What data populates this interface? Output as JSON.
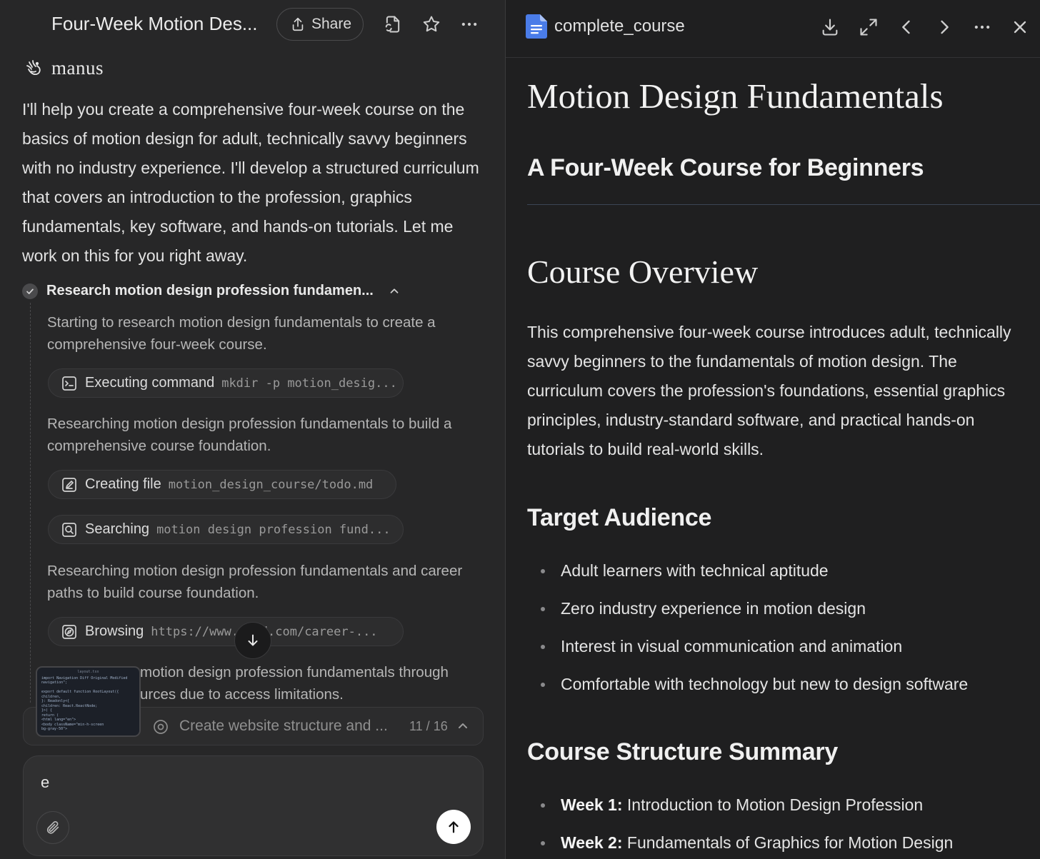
{
  "left": {
    "task_title": "Four-Week Motion Des...",
    "share_label": "Share",
    "brand": "manus",
    "intro": "I'll help you create a comprehensive four-week course on the basics of motion design for adult, technically savvy beginners with no industry experience. I'll develop a structured curriculum that covers an introduction to the profession, graphics fundamentals, key software, and hands-on tutorials. Let me work on this for you right away.",
    "step": {
      "title": "Research motion design profession fundamen...",
      "items": [
        {
          "type": "text",
          "text": "Starting to research motion design fundamentals to create a comprehensive four-week course."
        },
        {
          "type": "pill",
          "icon": "terminal-icon",
          "label": "Executing command",
          "detail": "mkdir -p motion_desig..."
        },
        {
          "type": "text",
          "text": "Researching motion design profession fundamentals to build a comprehensive course foundation."
        },
        {
          "type": "pill",
          "icon": "edit-file-icon",
          "label": "Creating file",
          "detail": "motion_design_course/todo.md"
        },
        {
          "type": "pill",
          "icon": "search-icon",
          "label": "Searching",
          "detail": "motion design profession fund..."
        },
        {
          "type": "text",
          "text": "Researching motion design profession fundamentals and career paths to build course foundation."
        },
        {
          "type": "pill",
          "icon": "compass-icon",
          "label": "Browsing",
          "detail": "https://www.    eed.com/career-..."
        },
        {
          "type": "text",
          "text": "motion design profession fundamentals through\nurces due to access limitations."
        }
      ]
    },
    "progress": {
      "current_task": "Create website structure and ...",
      "count": "11 / 16"
    },
    "thumbnail": {
      "title": "layout.tsx",
      "lines": [
        "import Navigation  Diff  Original  Modified",
        "navigation\";",
        "",
        "export default function RootLayout({",
        "  children,",
        "}: Readonly<{",
        "  children: React.ReactNode;",
        "}>) {",
        "  return (",
        "    <html lang=\"en\">",
        "      <body className=\"min-h-screen",
        "      bg-gray-50\">"
      ]
    },
    "input": {
      "value": "e"
    }
  },
  "right": {
    "filename": "complete_course",
    "doc": {
      "title": "Motion Design Fundamentals",
      "subtitle": "A Four-Week Course for Beginners",
      "overview_heading": "Course Overview",
      "overview_text": "This comprehensive four-week course introduces adult, technically savvy beginners to the fundamentals of motion design. The curriculum covers the profession's foundations, essential graphics principles, industry-standard software, and practical hands-on tutorials to build real-world skills.",
      "audience_heading": "Target Audience",
      "audience": [
        "Adult learners with technical aptitude",
        "Zero industry experience in motion design",
        "Interest in visual communication and animation",
        "Comfortable with technology but new to design software"
      ],
      "structure_heading": "Course Structure Summary",
      "structure": [
        {
          "week": "Week 1:",
          "text": " Introduction to Motion Design Profession"
        },
        {
          "week": "Week 2:",
          "text": " Fundamentals of Graphics for Motion Design"
        }
      ]
    }
  },
  "colors": {
    "left_bg": "#272728",
    "right_bg": "#1f1f20",
    "doc_icon_blue": "#4a7ce8",
    "send_button": "#ffffff"
  }
}
